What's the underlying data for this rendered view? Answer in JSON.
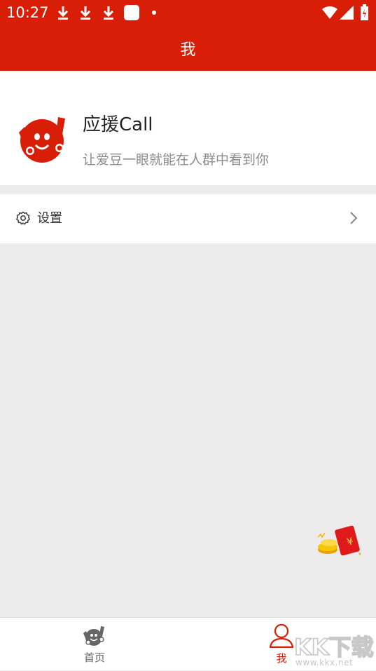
{
  "status_bar": {
    "time": "10:27",
    "icons": [
      "download-icon",
      "download-icon",
      "download-icon",
      "app-notification-icon",
      "dot-icon",
      "wifi-icon",
      "signal-icon",
      "battery-icon"
    ]
  },
  "header": {
    "title": "我"
  },
  "profile": {
    "name": "应援Call",
    "slogan": "让爱豆一眼就能在人群中看到你",
    "logo": "app-logo-icon"
  },
  "menu": {
    "settings": {
      "label": "设置",
      "icon": "gear-icon",
      "chevron": "chevron-right-icon"
    }
  },
  "floating": {
    "icon": "red-packet-icon"
  },
  "bottom_nav": {
    "items": [
      {
        "label": "首页",
        "icon": "home-logo-icon",
        "active": false
      },
      {
        "label": "我",
        "icon": "person-icon",
        "active": true
      }
    ]
  },
  "watermark": {
    "logo_text": "KK下载",
    "url": "www.kkx.net"
  },
  "colors": {
    "brand": "#d81e06",
    "background": "#ececec",
    "active_nav": "#d81e06",
    "inactive_nav": "#666666"
  }
}
